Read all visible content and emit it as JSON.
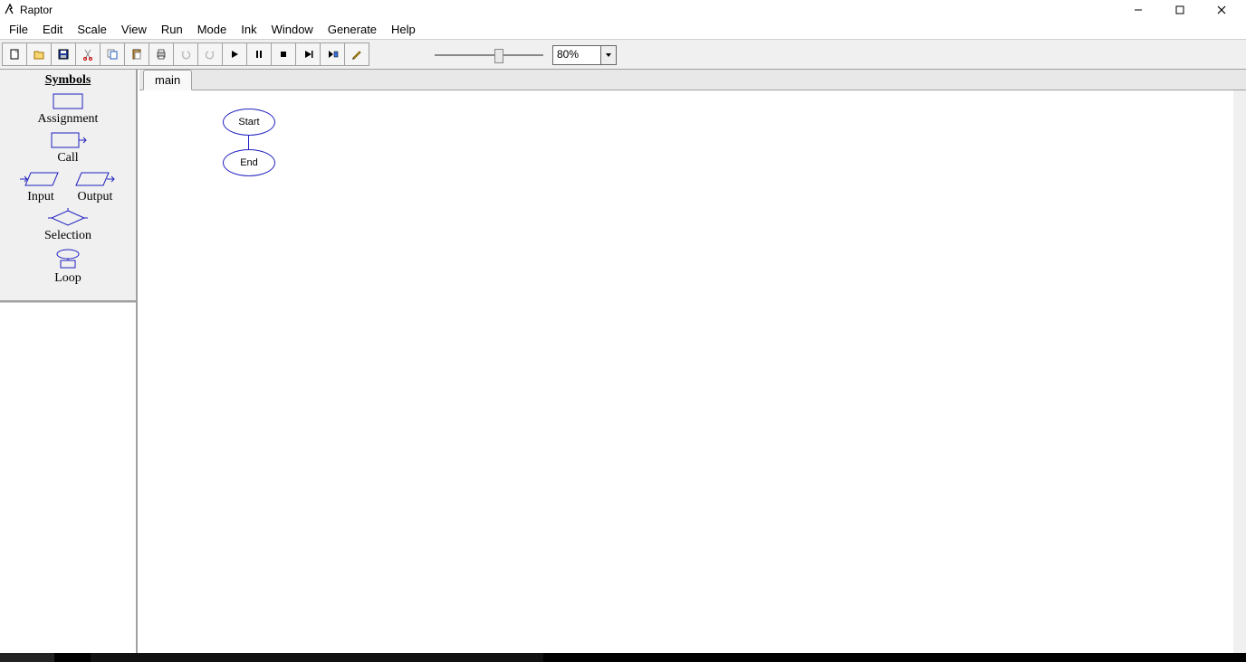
{
  "window": {
    "title": "Raptor",
    "controls": {
      "min": "minimize",
      "max": "maximize",
      "close": "close"
    }
  },
  "menu": {
    "items": [
      "File",
      "Edit",
      "Scale",
      "View",
      "Run",
      "Mode",
      "Ink",
      "Window",
      "Generate",
      "Help"
    ]
  },
  "toolbar": {
    "buttons": [
      "new",
      "open",
      "save",
      "cut",
      "copy",
      "paste",
      "print",
      "undo",
      "redo",
      "play",
      "pause",
      "stop",
      "step-over",
      "step-into",
      "pen"
    ],
    "zoom": "80%"
  },
  "sidebar": {
    "title": "Symbols",
    "assignment": "Assignment",
    "call": "Call",
    "input": "Input",
    "output": "Output",
    "selection": "Selection",
    "loop": "Loop"
  },
  "tabs": {
    "items": [
      "main"
    ]
  },
  "flowchart": {
    "start": "Start",
    "end": "End"
  }
}
